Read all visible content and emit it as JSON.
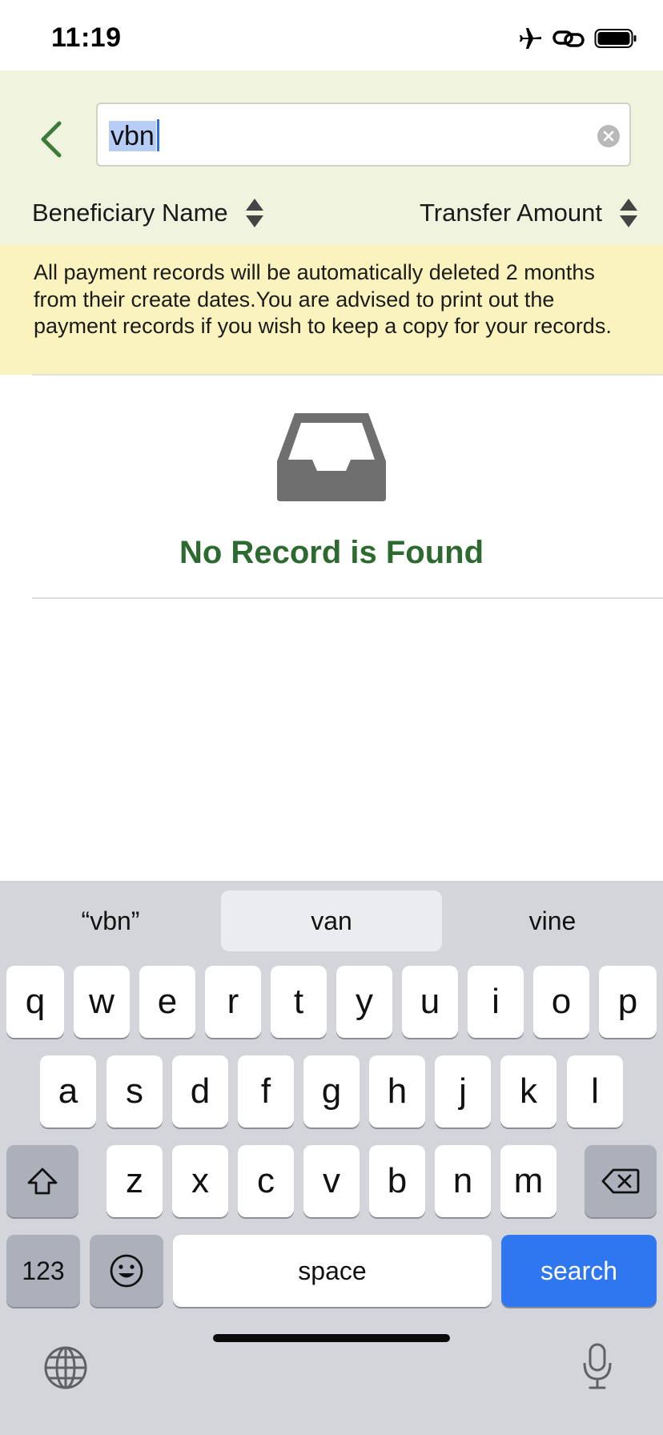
{
  "status_bar": {
    "time": "11:19",
    "icons": [
      "airplane-icon",
      "link-icon",
      "battery-icon"
    ]
  },
  "header": {
    "back_icon": "chevron-left-icon",
    "search": {
      "value": "vbn",
      "placeholder": ""
    },
    "sort": {
      "left_label": "Beneficiary Name",
      "right_label": "Transfer Amount"
    }
  },
  "notice": {
    "text": "All payment records will be automatically deleted 2 months from their create dates.You are advised to print out the payment records if you wish to keep a copy for your records."
  },
  "empty_state": {
    "icon": "inbox-icon",
    "message": "No Record is Found"
  },
  "keyboard": {
    "suggestions": [
      "“vbn”",
      "van",
      "vine"
    ],
    "row1": [
      "q",
      "w",
      "e",
      "r",
      "t",
      "y",
      "u",
      "i",
      "o",
      "p"
    ],
    "row2": [
      "a",
      "s",
      "d",
      "f",
      "g",
      "h",
      "j",
      "k",
      "l"
    ],
    "row3": [
      "z",
      "x",
      "c",
      "v",
      "b",
      "n",
      "m"
    ],
    "numbers_label": "123",
    "space_label": "space",
    "search_label": "search"
  },
  "colors": {
    "header_bg": "#f0f4df",
    "notice_bg": "#fbf3bd",
    "accent_green": "#2d6a2f",
    "search_key": "#2e77f0"
  }
}
